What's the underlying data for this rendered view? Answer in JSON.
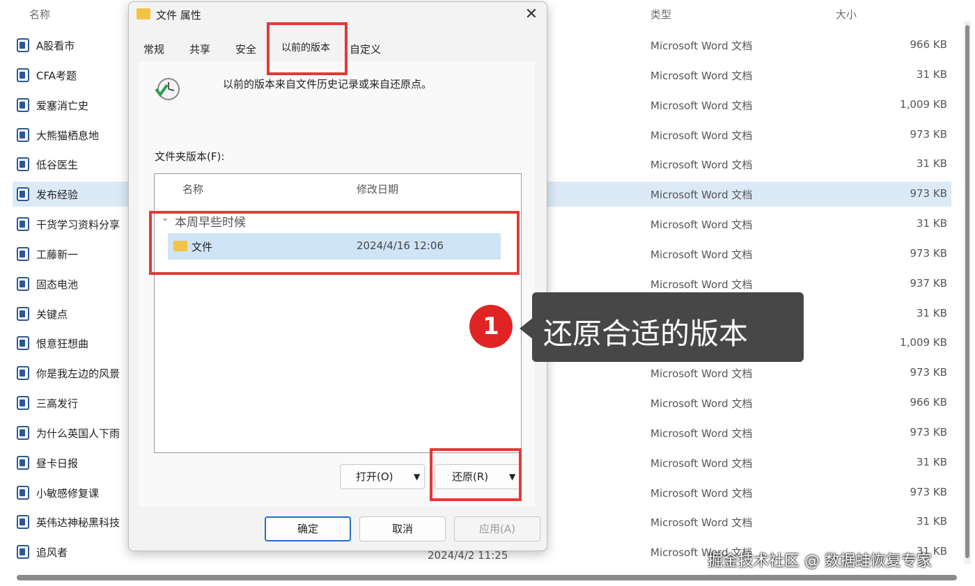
{
  "explorer": {
    "columns": {
      "name": "名称",
      "type": "类型",
      "size": "大小"
    },
    "files": [
      {
        "name": "A股看市",
        "type": "Microsoft Word 文档",
        "size": "966 KB"
      },
      {
        "name": "CFA考题",
        "type": "Microsoft Word 文档",
        "size": "31 KB"
      },
      {
        "name": "爱塞消亡史",
        "type": "Microsoft Word 文档",
        "size": "1,009 KB"
      },
      {
        "name": "大熊猫栖息地",
        "type": "Microsoft Word 文档",
        "size": "973 KB"
      },
      {
        "name": "低谷医生",
        "type": "Microsoft Word 文档",
        "size": "31 KB"
      },
      {
        "name": "发布经验",
        "type": "Microsoft Word 文档",
        "size": "973 KB"
      },
      {
        "name": "干货学习资料分享",
        "type": "Microsoft Word 文档",
        "size": "31 KB"
      },
      {
        "name": "工藤新一",
        "type": "Microsoft Word 文档",
        "size": "973 KB"
      },
      {
        "name": "固态电池",
        "type": "Microsoft Word 文档",
        "size": "937 KB"
      },
      {
        "name": "关键点",
        "type": "Microsoft Word 文档",
        "size": "31 KB"
      },
      {
        "name": "恨意狂想曲",
        "type": "Microsoft Word 文档",
        "size": "1,009 KB"
      },
      {
        "name": "你是我左边的风景",
        "type": "Microsoft Word 文档",
        "size": "973 KB"
      },
      {
        "name": "三高发行",
        "type": "Microsoft Word 文档",
        "size": "966 KB"
      },
      {
        "name": "为什么英国人下雨",
        "type": "Microsoft Word 文档",
        "size": "973 KB"
      },
      {
        "name": "昼卡日报",
        "type": "Microsoft Word 文档",
        "size": "31 KB"
      },
      {
        "name": "小敏感修复课",
        "type": "Microsoft Word 文档",
        "size": "973 KB"
      },
      {
        "name": "英伟达神秘黑科技",
        "type": "Microsoft Word 文档",
        "size": "31 KB"
      },
      {
        "name": "追风者",
        "type": "Microsoft Word 文档",
        "size": "31 KB",
        "date": "2024/4/2 11:25"
      }
    ]
  },
  "dialog": {
    "title": "文件 属性",
    "close_icon": "close-icon",
    "tabs": [
      "常规",
      "共享",
      "安全",
      "以前的版本",
      "自定义"
    ],
    "active_tab": "以前的版本",
    "description": "以前的版本来自文件历史记录或来自还原点。",
    "folder_versions_label": "文件夹版本(F):",
    "list_headers": {
      "name": "名称",
      "date": "修改日期"
    },
    "group_label": "本周早些时候",
    "version": {
      "name": "文件",
      "date": "2024/4/16 12:06"
    },
    "buttons": {
      "open": "打开(O)",
      "restore": "还原(R)",
      "ok": "确定",
      "cancel": "取消",
      "apply": "应用(A)"
    }
  },
  "callout": {
    "number": "1",
    "text": "还原合适的版本"
  },
  "watermark": "掘金技术社区 @ 数据蛙恢复专家",
  "colors": {
    "highlight_red": "#e53935",
    "selection_blue": "#cfe4f7",
    "folder_yellow": "#f3c343",
    "callout_bg": "#474747"
  }
}
